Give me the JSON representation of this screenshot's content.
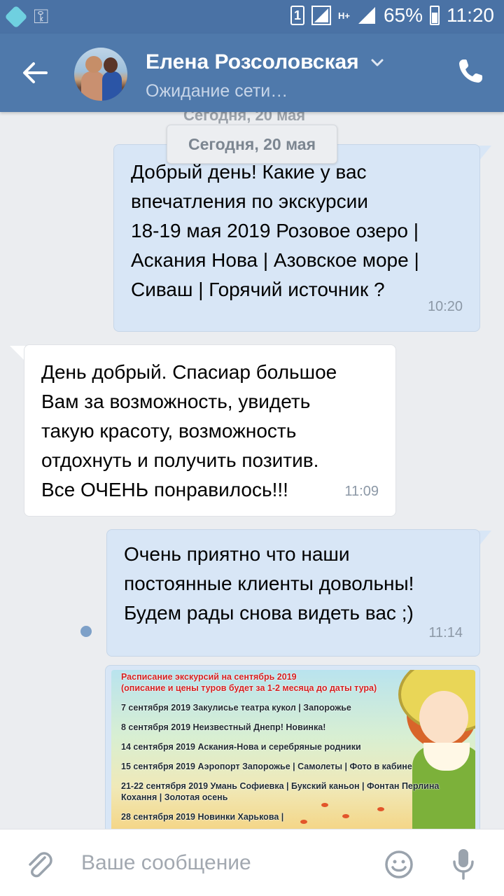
{
  "status_bar": {
    "sim_label": "1",
    "network_label": "H+",
    "battery": "65%",
    "time": "11:20"
  },
  "header": {
    "contact_name": "Елена Розсоловская",
    "contact_status": "Ожидание сети…"
  },
  "chat": {
    "date_ghost": "Сегодня, 20 мая",
    "date_label": "Сегодня, 20 мая",
    "messages": [
      {
        "direction": "out",
        "text": "Добрый день! Какие у вас\nвпечатления по экскурсии\n18-19 мая 2019 Розовое озеро |\nАскания Нова | Азовское море |\nСиваш | Горячий источник ?",
        "time": "10:20"
      },
      {
        "direction": "in",
        "text": "День добрый. Спасиар большое\nВам за возможность, увидеть\nтакую красоту, возможность\nотдохнуть и получить позитив.\nВсе ОЧЕНЬ понравилось!!!",
        "time": "11:09"
      },
      {
        "direction": "out",
        "text": "Очень  приятно что наши\nпостоянные клиенты довольны!\nБудем рады снова видеть вас ;)",
        "time": "11:14"
      }
    ],
    "poster": {
      "lines": [
        "Расписание экскурсий на сентябрь 2019",
        "(описание и цены туров будет за 1-2 месяца до даты тура)",
        "7 сентября 2019 Закулисье театра кукол | Запорожье",
        "8 сентября 2019 Неизвестный Днепр! Новинка!",
        "14 сентября 2019 Аскания-Нова и серебряные родники",
        "15 сентября 2019 Аэропорт Запорожье | Самолеты | Фото в кабине",
        "21-22 сентября 2019 Умань Софиевка | Букский каньон | Фонтан Перлина",
        "Кохання | Золотая осень",
        "28 сентября 2019 Новинки Харькова |"
      ]
    }
  },
  "composer": {
    "placeholder": "Ваше сообщение"
  },
  "icons": {
    "back": "back-arrow-icon",
    "call": "phone-icon",
    "attach": "paperclip-icon",
    "emoji": "smiley-icon",
    "mic": "microphone-icon"
  },
  "colors": {
    "header": "#4f79ab",
    "status_bar": "#4a72a5",
    "outgoing_bubble": "#d8e6f6",
    "incoming_bubble": "#ffffff",
    "chat_background": "#ebedf0"
  }
}
